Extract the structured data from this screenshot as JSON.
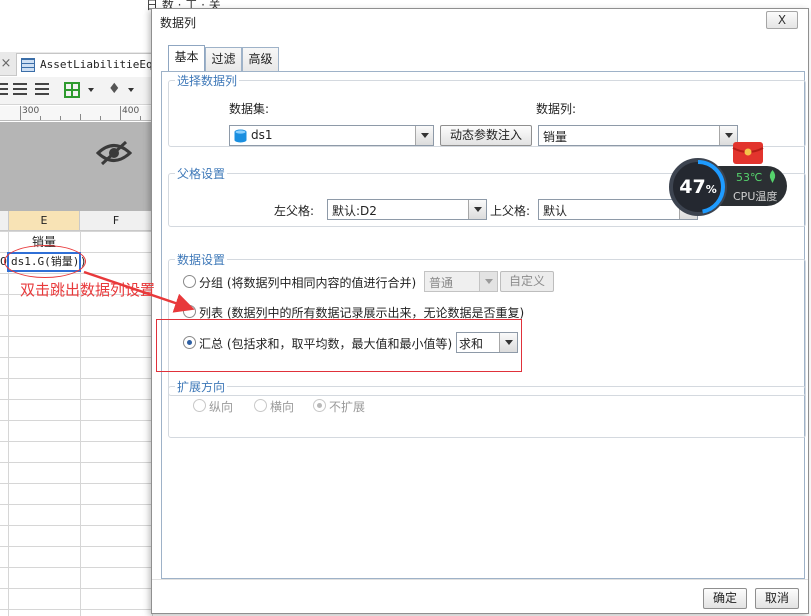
{
  "background_app": {
    "window_title": "日 数 · 工 · 关",
    "tab_close_glyph": "×",
    "report_tab_label": "AssetLiabilitieEqui",
    "ruler_marks": [
      "300",
      "400"
    ],
    "column_headers": [
      "E",
      "F"
    ],
    "cells": {
      "e1": "销量",
      "d2_fragment": "0",
      "e2": "ds1.G(销量)",
      "f2_fragment": ")"
    },
    "annotation_text": "双击跳出数据列设置",
    "annotation_color": "#e8393b"
  },
  "dialog": {
    "title": "数据列",
    "close_glyph": "X",
    "tabs": [
      {
        "label": "基本",
        "active": true
      },
      {
        "label": "过滤",
        "active": false
      },
      {
        "label": "高级",
        "active": false
      }
    ],
    "select_column_group": {
      "legend": "选择数据列",
      "dataset_label": "数据集:",
      "dataset_value": "ds1",
      "dynamic_param_button": "动态参数注入",
      "column_label": "数据列:",
      "column_value": "销量"
    },
    "parent_group": {
      "legend": "父格设置",
      "left_parent_label": "左父格:",
      "left_parent_value": "默认:D2",
      "top_parent_label": "上父格:",
      "top_parent_value": "默认"
    },
    "data_setting_group": {
      "legend": "数据设置",
      "group_option": "分组 (将数据列中相同内容的值进行合并)",
      "group_mode_value": "普通",
      "custom_button": "自定义",
      "list_option": "列表 (数据列中的所有数据记录展示出来，无论数据是否重复)",
      "summary_option": "汇总 (包括求和，取平均数，最大值和最小值等)",
      "summary_function_value": "求和",
      "selected": "summary",
      "highlight_color": "#e0313a"
    },
    "expand_group": {
      "legend": "扩展方向",
      "options": [
        "纵向",
        "横向",
        "不扩展"
      ],
      "selected": "不扩展"
    },
    "footer": {
      "ok_label": "确定",
      "cancel_label": "取消"
    }
  },
  "cpu_widget": {
    "usage_percent": "47",
    "percent_sign": "%",
    "temperature": "53℃",
    "label": "CPU温度",
    "ring_color": "#1e9bff",
    "temp_color": "#55d26c"
  }
}
